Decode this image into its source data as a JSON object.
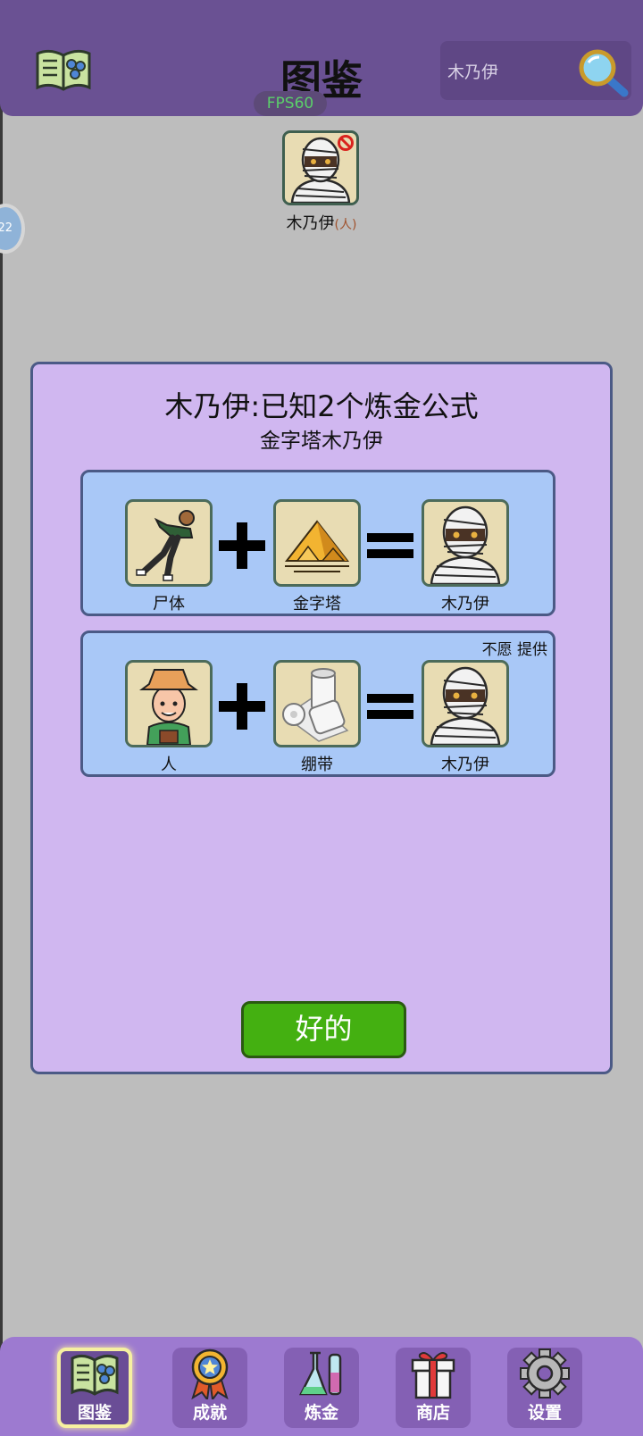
{
  "header": {
    "title": "图鉴",
    "fps": "FPS60",
    "search_value": "木乃伊"
  },
  "item": {
    "name": "木乃伊",
    "tag": "(人)"
  },
  "side_bubble": "22",
  "dialog": {
    "title": "木乃伊:已知2个炼金公式",
    "subtitle": "金字塔木乃伊",
    "recipes": [
      {
        "inputs": [
          "尸体",
          "金字塔"
        ],
        "output": "木乃伊",
        "note": ""
      },
      {
        "inputs": [
          "人",
          "绷带"
        ],
        "output": "木乃伊",
        "note": "不愿 提供"
      }
    ],
    "ok_label": "好的"
  },
  "nav": {
    "items": [
      {
        "label": "图鉴",
        "icon": "book-icon",
        "active": true
      },
      {
        "label": "成就",
        "icon": "medal-icon",
        "active": false
      },
      {
        "label": "炼金",
        "icon": "flask-icon",
        "active": false
      },
      {
        "label": "商店",
        "icon": "gift-icon",
        "active": false
      },
      {
        "label": "设置",
        "icon": "gear-icon",
        "active": false
      }
    ]
  },
  "colors": {
    "header": "#6a5193",
    "background": "#bdbdbd",
    "dialog": "#d0b7f0",
    "recipe": "#a9c8f7",
    "ok_button": "#44b011",
    "nav": "#9d7ad0"
  }
}
